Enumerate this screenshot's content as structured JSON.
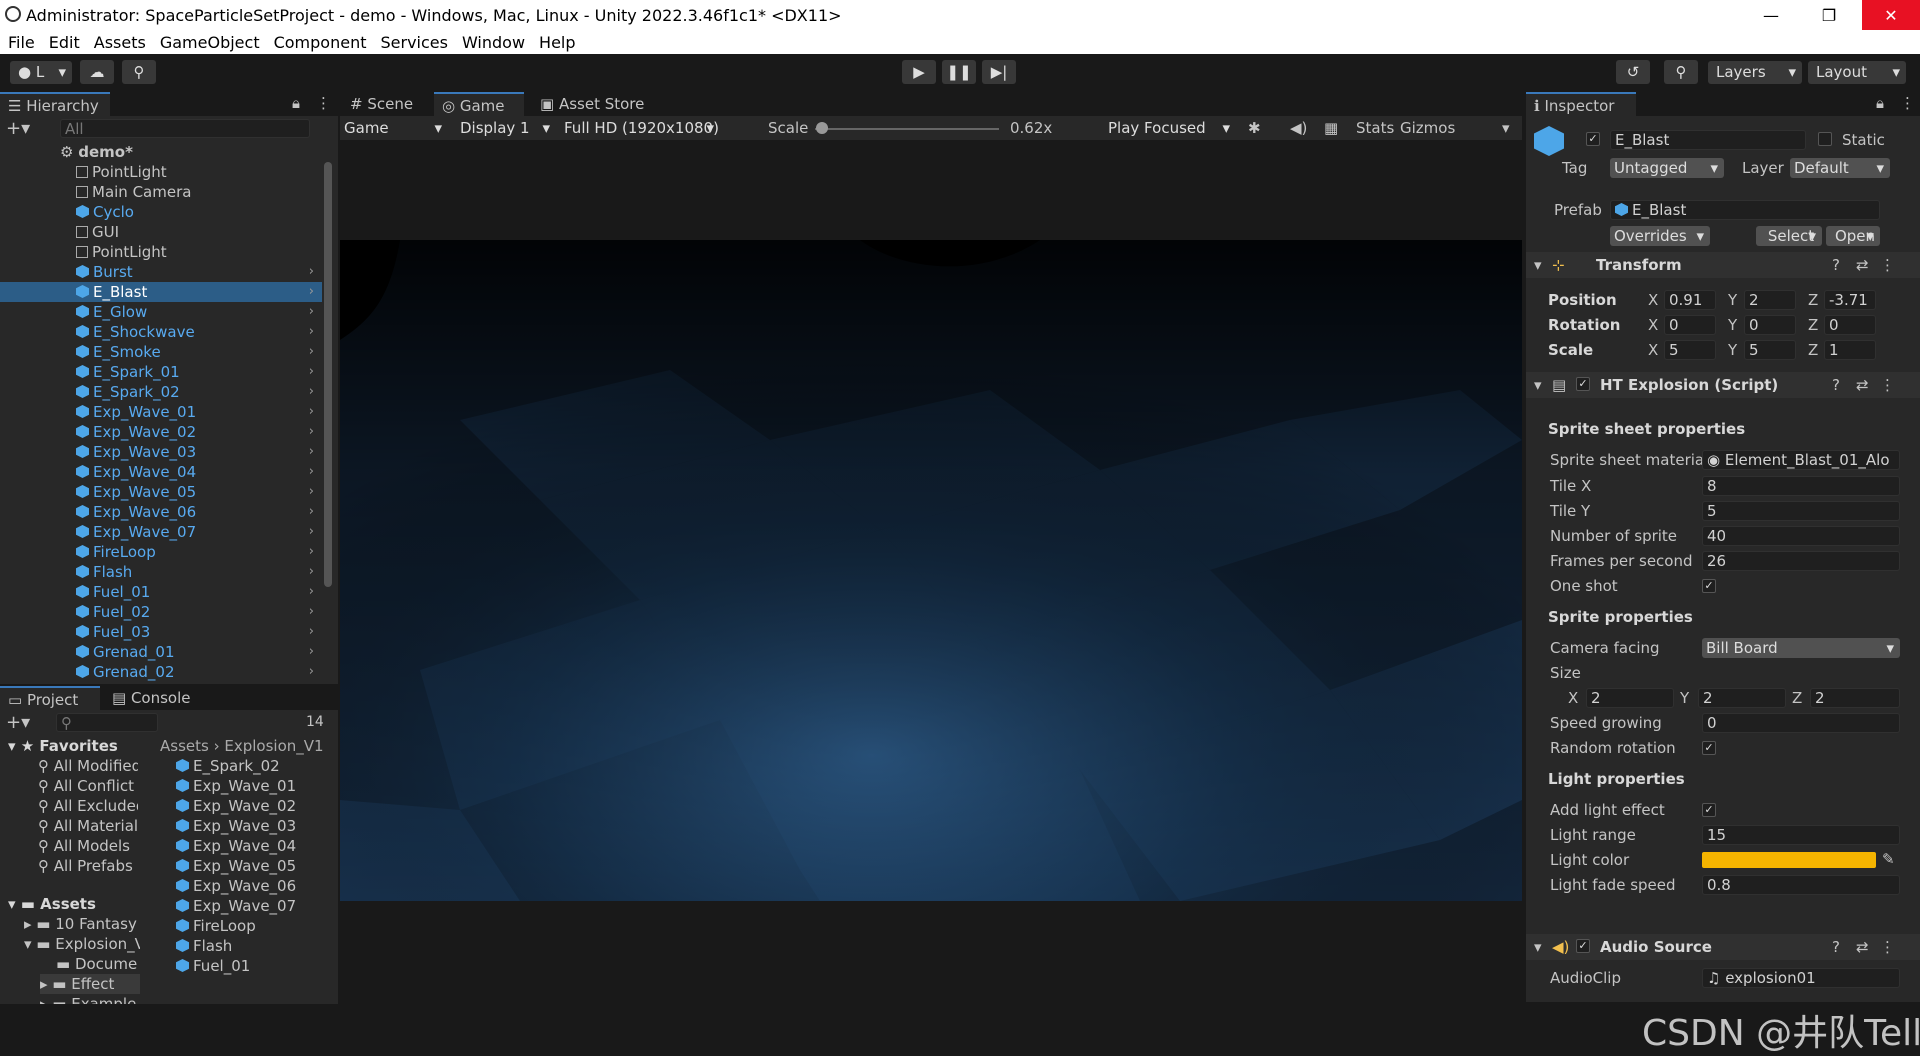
{
  "window": {
    "title": "Administrator: SpaceParticleSetProject - demo - Windows, Mac, Linux - Unity 2022.3.46f1c1* <DX11>",
    "minimize": "—",
    "maximize": "❐",
    "close": "✕"
  },
  "menu": [
    "File",
    "Edit",
    "Assets",
    "GameObject",
    "Component",
    "Services",
    "Window",
    "Help"
  ],
  "toolbar": {
    "account": "L",
    "layers": "Layers",
    "layout": "Layout"
  },
  "hierarchy": {
    "tab": "Hierarchy",
    "search_placeholder": "All",
    "scene": "demo*",
    "items": [
      {
        "label": "PointLight",
        "prefab": false
      },
      {
        "label": "Main Camera",
        "prefab": false
      },
      {
        "label": "Cyclo",
        "prefab": true
      },
      {
        "label": "GUI",
        "prefab": false
      },
      {
        "label": "PointLight",
        "prefab": false
      },
      {
        "label": "Burst",
        "prefab": true
      },
      {
        "label": "E_Blast",
        "prefab": true
      },
      {
        "label": "E_Glow",
        "prefab": true
      },
      {
        "label": "E_Shockwave",
        "prefab": true
      },
      {
        "label": "E_Smoke",
        "prefab": true
      },
      {
        "label": "E_Spark_01",
        "prefab": true
      },
      {
        "label": "E_Spark_02",
        "prefab": true
      },
      {
        "label": "Exp_Wave_01",
        "prefab": true
      },
      {
        "label": "Exp_Wave_02",
        "prefab": true
      },
      {
        "label": "Exp_Wave_03",
        "prefab": true
      },
      {
        "label": "Exp_Wave_04",
        "prefab": true
      },
      {
        "label": "Exp_Wave_05",
        "prefab": true
      },
      {
        "label": "Exp_Wave_06",
        "prefab": true
      },
      {
        "label": "Exp_Wave_07",
        "prefab": true
      },
      {
        "label": "FireLoop",
        "prefab": true
      },
      {
        "label": "Flash",
        "prefab": true
      },
      {
        "label": "Fuel_01",
        "prefab": true
      },
      {
        "label": "Fuel_02",
        "prefab": true
      },
      {
        "label": "Fuel_03",
        "prefab": true
      },
      {
        "label": "Grenad_01",
        "prefab": true
      },
      {
        "label": "Grenad_02",
        "prefab": true
      }
    ],
    "selected": "E_Blast"
  },
  "project": {
    "tab_project": "Project",
    "tab_console": "Console",
    "hidden_count": "14",
    "favorites_label": "Favorites",
    "favorites": [
      "All Modified",
      "All Conflict",
      "All Excluded",
      "All Materials",
      "All Models",
      "All Prefabs"
    ],
    "assets_label": "Assets",
    "tree": [
      "10 Fantasy",
      "Explosion_V",
      "Docume",
      "Effect",
      "Example"
    ],
    "breadcrumb": [
      "Assets",
      "Explosion_V1"
    ],
    "files": [
      "E_Spark_02",
      "Exp_Wave_01",
      "Exp_Wave_02",
      "Exp_Wave_03",
      "Exp_Wave_04",
      "Exp_Wave_05",
      "Exp_Wave_06",
      "Exp_Wave_07",
      "FireLoop",
      "Flash",
      "Fuel_01"
    ]
  },
  "game": {
    "tab_scene": "Scene",
    "tab_game": "Game",
    "tab_store": "Asset Store",
    "mode": "Game",
    "display": "Display 1",
    "resolution": "Full HD (1920x1080)",
    "scale_label": "Scale",
    "scale_value": "0.62x",
    "play_focused": "Play Focused",
    "stats": "Stats",
    "gizmos": "Gizmos"
  },
  "inspector": {
    "tab": "Inspector",
    "object_name": "E_Blast",
    "static_label": "Static",
    "tag_label": "Tag",
    "tag_value": "Untagged",
    "layer_label": "Layer",
    "layer_value": "Default",
    "prefab_label": "Prefab",
    "prefab_value": "E_Blast",
    "overrides": "Overrides",
    "select": "Select",
    "open": "Open",
    "transform": {
      "title": "Transform",
      "position_label": "Position",
      "position": {
        "x": "0.91",
        "y": "2",
        "z": "-3.71"
      },
      "rotation_label": "Rotation",
      "rotation": {
        "x": "0",
        "y": "0",
        "z": "0"
      },
      "scale_label": "Scale",
      "scale": {
        "x": "5",
        "y": "5",
        "z": "1"
      }
    },
    "script": {
      "title": "HT Explosion (Script)",
      "sprite_sheet_header": "Sprite sheet properties",
      "sprite_sheet_material_label": "Sprite sheet material",
      "sprite_sheet_material": "Element_Blast_01_Alo",
      "tile_x_label": "Tile X",
      "tile_x": "8",
      "tile_y_label": "Tile Y",
      "tile_y": "5",
      "num_sprite_label": "Number of sprite",
      "num_sprite": "40",
      "fps_label": "Frames per second",
      "fps": "26",
      "one_shot_label": "One shot",
      "sprite_header": "Sprite properties",
      "camera_facing_label": "Camera facing",
      "camera_facing": "Bill Board",
      "size_label": "Size",
      "size": {
        "x": "2",
        "y": "2",
        "z": "2"
      },
      "speed_growing_label": "Speed growing",
      "speed_growing": "0",
      "random_rotation_label": "Random rotation",
      "light_header": "Light properties",
      "add_light_label": "Add light effect",
      "light_range_label": "Light range",
      "light_range": "15",
      "light_color_label": "Light color",
      "light_color": "#f5b400",
      "light_fade_label": "Light fade speed",
      "light_fade": "0.8"
    },
    "audio": {
      "title": "Audio Source",
      "clip_label": "AudioClip",
      "clip_value": "explosion01"
    }
  },
  "watermark": "CSDN @井队Tell"
}
